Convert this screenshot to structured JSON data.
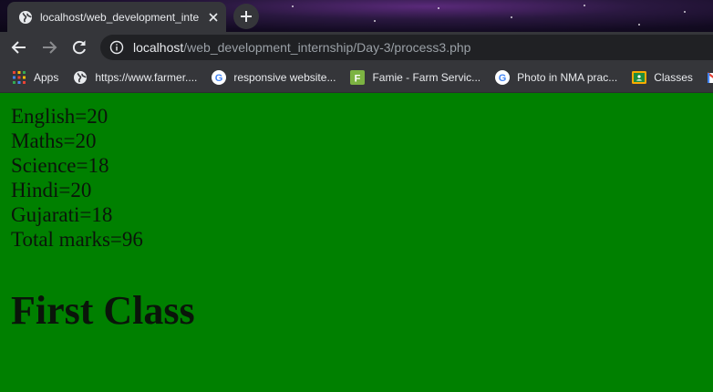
{
  "browser": {
    "tab": {
      "title": "localhost/web_development_inte"
    },
    "address": {
      "host": "localhost",
      "path": "/web_development_internship/Day-3/process3.php"
    },
    "bookmarks": [
      {
        "label": "Apps",
        "icon": "apps-grid-icon"
      },
      {
        "label": "https://www.farmer....",
        "icon": "globe-icon"
      },
      {
        "label": "responsive website...",
        "icon": "google-icon"
      },
      {
        "label": "Famie - Farm Servic...",
        "icon": "famie-icon"
      },
      {
        "label": "Photo in NMA prac...",
        "icon": "google-icon"
      },
      {
        "label": "Classes",
        "icon": "classroom-icon"
      },
      {
        "label": "",
        "icon": "gmail-icon"
      }
    ]
  },
  "page": {
    "background": "#008000",
    "lines": [
      "English=20",
      "Maths=20",
      "Science=18",
      "Hindi=20",
      "Gujarati=18",
      "Total marks=96"
    ],
    "result": "First Class"
  }
}
